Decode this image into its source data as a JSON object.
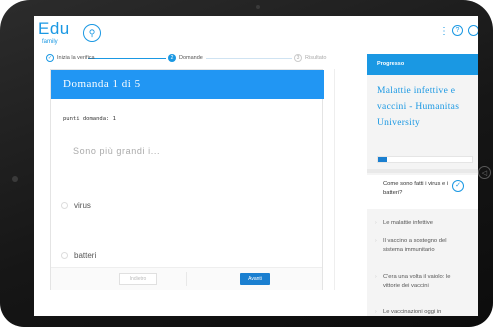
{
  "brand": {
    "logo": "Edu",
    "sub": "family"
  },
  "header": {
    "dots_icon": "⋮",
    "help_icon": "?"
  },
  "steps": [
    {
      "label": "Inizia la verifica",
      "marker": "✓"
    },
    {
      "label": "Domande",
      "marker": "2"
    },
    {
      "label": "Risultato",
      "marker": "3"
    }
  ],
  "question": {
    "title": "Domanda 1 di 5",
    "points": "punti domanda: 1",
    "text": "Sono più grandi i...",
    "options": [
      "virus",
      "batteri"
    ],
    "back_label": "Indietro",
    "next_label": "Avanti"
  },
  "sidebar": {
    "header": "Progresso",
    "course_title": "Malattie infettive e vaccini - Humanitas University",
    "progress": 0.1,
    "lessons": [
      {
        "label": "Come sono fatti i virus e i batteri?",
        "active": true
      },
      {
        "label": "Le malattie infettive",
        "active": false
      },
      {
        "label": "Il vaccino a sostegno del sistema immunitario",
        "active": false
      },
      {
        "label": "C'era una volta il vaiolo: le vittorie dei vaccini",
        "active": false
      },
      {
        "label": "Le vaccinazioni oggi in Italia",
        "active": false
      }
    ]
  },
  "colors": {
    "accent": "#1a98e3",
    "header_blue": "#2196f3",
    "button_blue": "#1a7fd0"
  }
}
